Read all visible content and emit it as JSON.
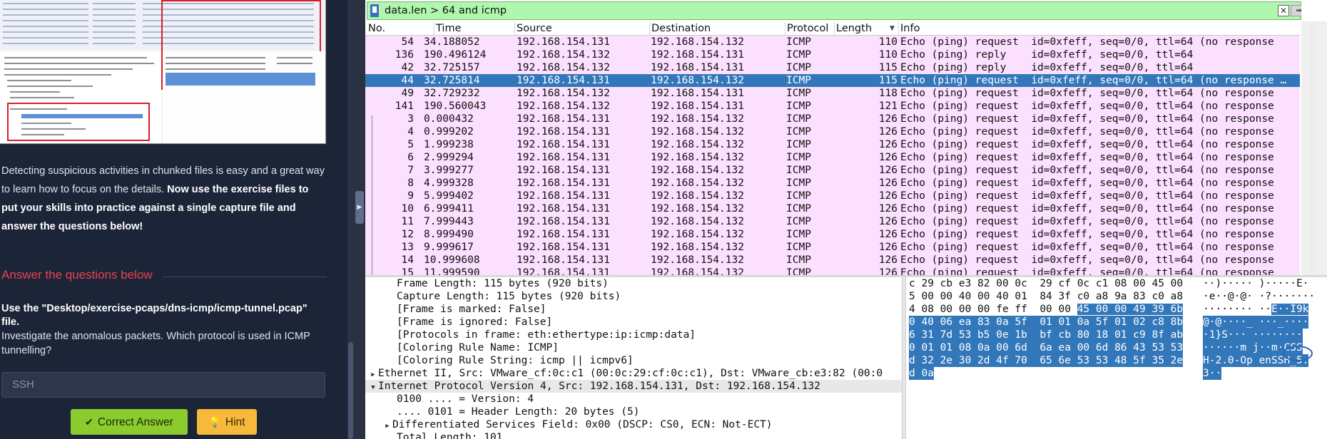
{
  "instructions": {
    "paragraph_plain": "Detecting suspicious activities in chunked files is easy and a great way to learn how to focus on the details. ",
    "paragraph_bold": "Now use the exercise files to put your skills into practice against a single capture file and answer the questions below!",
    "section_heading": "Answer the questions below",
    "question_title": "Use the \"Desktop/exercise-pcaps/dns-icmp/icmp-tunnel.pcap\" file.",
    "question_body": "Investigate the anomalous packets. Which protocol is used in ICMP tunnelling?",
    "answer_value": "SSH",
    "correct_label": "Correct Answer",
    "hint_label": "Hint"
  },
  "wireshark": {
    "filter": "data.len > 64 and icmp",
    "columns": [
      "No.",
      "Time",
      "Source",
      "Destination",
      "Protocol",
      "Length",
      "Info"
    ],
    "packets": [
      {
        "no": "54",
        "time": "34.188052",
        "src": "192.168.154.131",
        "dst": "192.168.154.132",
        "proto": "ICMP",
        "len": "110",
        "info": "Echo (ping) request  id=0xfeff, seq=0/0, ttl=64 (no response"
      },
      {
        "no": "136",
        "time": "190.496124",
        "src": "192.168.154.132",
        "dst": "192.168.154.131",
        "proto": "ICMP",
        "len": "110",
        "info": "Echo (ping) reply    id=0xfeff, seq=0/0, ttl=64"
      },
      {
        "no": "42",
        "time": "32.725157",
        "src": "192.168.154.132",
        "dst": "192.168.154.131",
        "proto": "ICMP",
        "len": "115",
        "info": "Echo (ping) reply    id=0xfeff, seq=0/0, ttl=64"
      },
      {
        "no": "44",
        "time": "32.725814",
        "src": "192.168.154.131",
        "dst": "192.168.154.132",
        "proto": "ICMP",
        "len": "115",
        "info": "Echo (ping) request  id=0xfeff, seq=0/0, ttl=64 (no response …"
      },
      {
        "no": "49",
        "time": "32.729232",
        "src": "192.168.154.132",
        "dst": "192.168.154.131",
        "proto": "ICMP",
        "len": "118",
        "info": "Echo (ping) request  id=0xfeff, seq=0/0, ttl=64 (no response"
      },
      {
        "no": "141",
        "time": "190.560043",
        "src": "192.168.154.132",
        "dst": "192.168.154.131",
        "proto": "ICMP",
        "len": "121",
        "info": "Echo (ping) request  id=0xfeff, seq=0/0, ttl=64 (no response"
      },
      {
        "no": "3",
        "time": "0.000432",
        "src": "192.168.154.131",
        "dst": "192.168.154.132",
        "proto": "ICMP",
        "len": "126",
        "info": "Echo (ping) request  id=0xfeff, seq=0/0, ttl=64 (no response"
      },
      {
        "no": "4",
        "time": "0.999202",
        "src": "192.168.154.131",
        "dst": "192.168.154.132",
        "proto": "ICMP",
        "len": "126",
        "info": "Echo (ping) request  id=0xfeff, seq=0/0, ttl=64 (no response"
      },
      {
        "no": "5",
        "time": "1.999238",
        "src": "192.168.154.131",
        "dst": "192.168.154.132",
        "proto": "ICMP",
        "len": "126",
        "info": "Echo (ping) request  id=0xfeff, seq=0/0, ttl=64 (no response"
      },
      {
        "no": "6",
        "time": "2.999294",
        "src": "192.168.154.131",
        "dst": "192.168.154.132",
        "proto": "ICMP",
        "len": "126",
        "info": "Echo (ping) request  id=0xfeff, seq=0/0, ttl=64 (no response"
      },
      {
        "no": "7",
        "time": "3.999277",
        "src": "192.168.154.131",
        "dst": "192.168.154.132",
        "proto": "ICMP",
        "len": "126",
        "info": "Echo (ping) request  id=0xfeff, seq=0/0, ttl=64 (no response"
      },
      {
        "no": "8",
        "time": "4.999328",
        "src": "192.168.154.131",
        "dst": "192.168.154.132",
        "proto": "ICMP",
        "len": "126",
        "info": "Echo (ping) request  id=0xfeff, seq=0/0, ttl=64 (no response"
      },
      {
        "no": "9",
        "time": "5.999402",
        "src": "192.168.154.131",
        "dst": "192.168.154.132",
        "proto": "ICMP",
        "len": "126",
        "info": "Echo (ping) request  id=0xfeff, seq=0/0, ttl=64 (no response"
      },
      {
        "no": "10",
        "time": "6.999411",
        "src": "192.168.154.131",
        "dst": "192.168.154.132",
        "proto": "ICMP",
        "len": "126",
        "info": "Echo (ping) request  id=0xfeff, seq=0/0, ttl=64 (no response"
      },
      {
        "no": "11",
        "time": "7.999443",
        "src": "192.168.154.131",
        "dst": "192.168.154.132",
        "proto": "ICMP",
        "len": "126",
        "info": "Echo (ping) request  id=0xfeff, seq=0/0, ttl=64 (no response"
      },
      {
        "no": "12",
        "time": "8.999490",
        "src": "192.168.154.131",
        "dst": "192.168.154.132",
        "proto": "ICMP",
        "len": "126",
        "info": "Echo (ping) request  id=0xfeff, seq=0/0, ttl=64 (no response"
      },
      {
        "no": "13",
        "time": "9.999617",
        "src": "192.168.154.131",
        "dst": "192.168.154.132",
        "proto": "ICMP",
        "len": "126",
        "info": "Echo (ping) request  id=0xfeff, seq=0/0, ttl=64 (no response"
      },
      {
        "no": "14",
        "time": "10.999608",
        "src": "192.168.154.131",
        "dst": "192.168.154.132",
        "proto": "ICMP",
        "len": "126",
        "info": "Echo (ping) request  id=0xfeff, seq=0/0, ttl=64 (no response"
      },
      {
        "no": "15",
        "time": "11.999590",
        "src": "192.168.154.131",
        "dst": "192.168.154.132",
        "proto": "ICMP",
        "len": "126",
        "info": "Echo (ping) request  id=0xfeff, seq=0/0, ttl=64 (no response"
      }
    ],
    "details": [
      "Frame Length: 115 bytes (920 bits)",
      "Capture Length: 115 bytes (920 bits)",
      "[Frame is marked: False]",
      "[Frame is ignored: False]",
      "[Protocols in frame: eth:ethertype:ip:icmp:data]",
      "[Coloring Rule Name: ICMP]",
      "[Coloring Rule String: icmp || icmpv6]",
      "Ethernet II, Src: VMware_cf:0c:c1 (00:0c:29:cf:0c:c1), Dst: VMware_cb:e3:82 (00:0",
      "Internet Protocol Version 4, Src: 192.168.154.131, Dst: 192.168.154.132",
      "0100 .... = Version: 4",
      ".... 0101 = Header Length: 20 bytes (5)",
      "Differentiated Services Field: 0x00 (DSCP: CS0, ECN: Not-ECT)",
      "Total Length: 101"
    ],
    "hex": [
      {
        "bytes": "c 29 cb e3 82 00 0c  29 cf 0c c1 08 00 45 00",
        "ascii": "··)····· )·····E·"
      },
      {
        "bytes": "5 00 00 40 00 40 01  84 3f c0 a8 9a 83 c0 a8",
        "ascii": "·e··@·@· ·?·······"
      },
      {
        "bytes_pre": "4 08 00 00 00 fe ff  00 00 ",
        "bytes_sel": "45 00 00 49 39 6b",
        "ascii_pre": "········ ··",
        "ascii_sel": "E··I9k"
      },
      {
        "bytes_sel": "0 40 06 ea 83 0a 5f  01 01 0a 5f 01 02 c8 8b",
        "ascii_sel": "@·@····_ ···_····"
      },
      {
        "bytes_sel": "6 31 7d 53 b5 0e 1b  bf cb 80 18 01 c9 8f ab",
        "ascii_sel": "·1}S··· ········"
      },
      {
        "bytes_sel": "0 01 01 08 0a 00 6d  6a ea 00 6d 86 43 53 53",
        "ascii_sel": "······m j··m·CSS"
      },
      {
        "bytes_sel": "d 32 2e 30 2d 4f 70  65 6e 53 53 48 5f 35 2e",
        "ascii_sel": "H-2.0-Op enSSH_5."
      },
      {
        "bytes_sel": "d 0a",
        "ascii_sel": "3··"
      }
    ],
    "colors": {
      "row_bg": "#fce0ff",
      "row_selected": "#3277ba",
      "filter_bg": "#aff7ae"
    }
  }
}
